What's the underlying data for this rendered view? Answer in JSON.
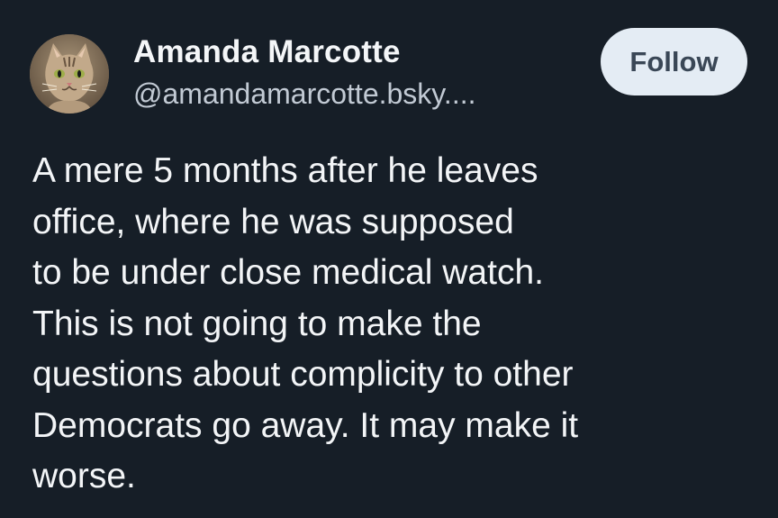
{
  "author": {
    "display_name": "Amanda Marcotte",
    "handle": "@amandamarcotte.bsky...."
  },
  "follow_button": {
    "label": "Follow"
  },
  "post": {
    "lines": [
      "A mere 5 months after he leaves",
      "office, where he was supposed",
      "to be under close medical watch.",
      "This is not going to make the",
      "questions about complicity to other",
      "Democrats go away. It may make it",
      "worse."
    ]
  },
  "icons": {
    "avatar": "cat-avatar-icon"
  },
  "colors": {
    "background": "#161e27",
    "button_bg": "#e4ecf4",
    "button_text": "#3a4756",
    "handle_text": "#c2cad4"
  }
}
